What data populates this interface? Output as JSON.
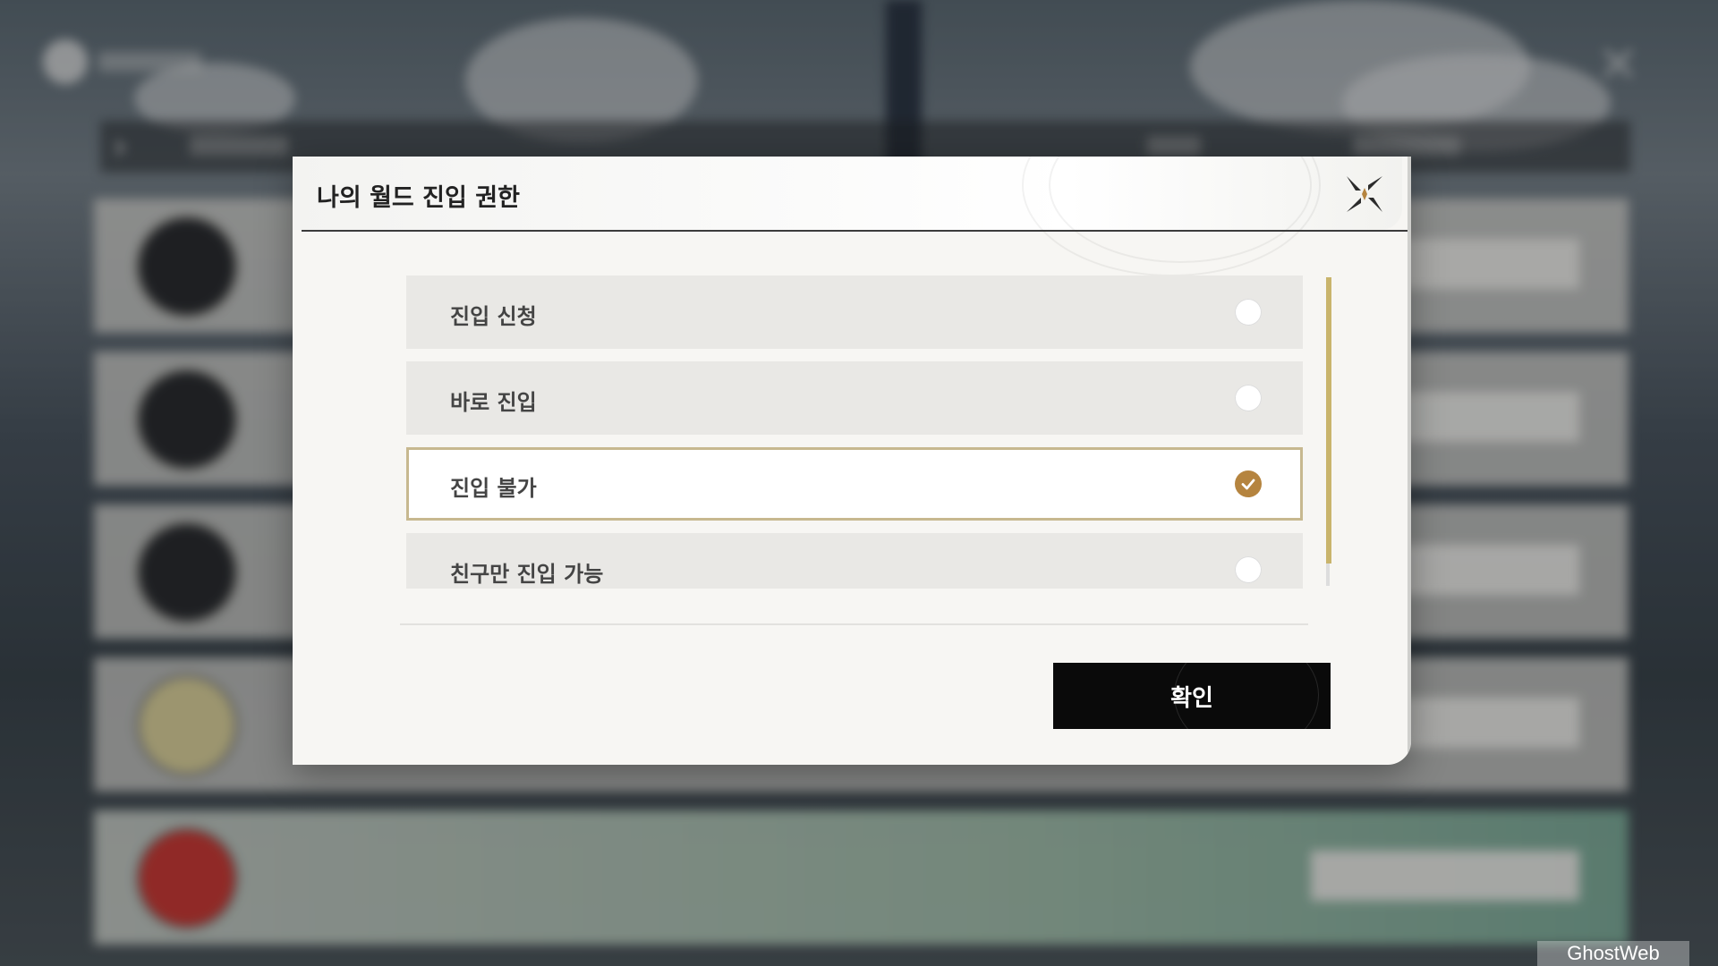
{
  "dialog": {
    "title": "나의 월드 진입 권한",
    "options": [
      {
        "label": "진입 신청",
        "selected": false
      },
      {
        "label": "바로 진입",
        "selected": false
      },
      {
        "label": "진입 불가",
        "selected": true
      },
      {
        "label": "친구만 진입 가능",
        "selected": false
      }
    ],
    "confirm_label": "확인",
    "close_icon": "close-x-icon",
    "checkmark_icon": "checkmark-icon"
  },
  "watermark": "GhostWeb",
  "colors": {
    "accent_gold": "#b5843f",
    "selected_border": "#c7b88f",
    "scrollbar": "#c9b46c",
    "confirm_bg": "#0a0a0a"
  }
}
